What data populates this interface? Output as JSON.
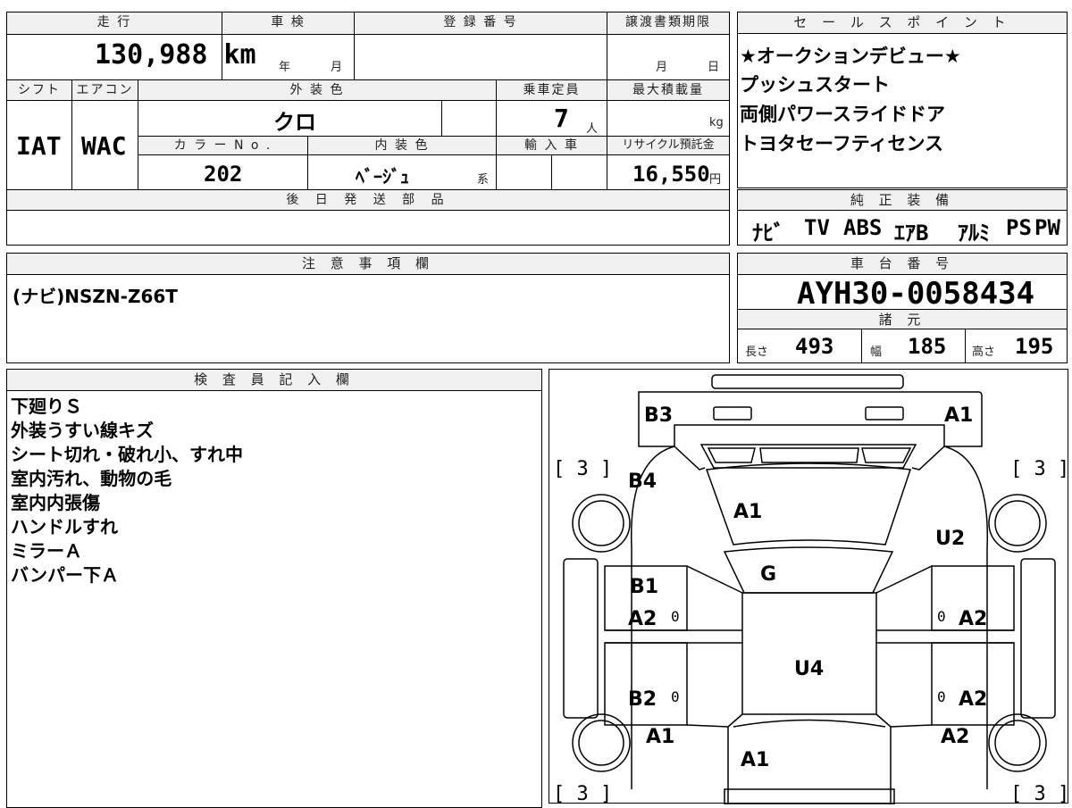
{
  "vehicle": {
    "headers": {
      "mileage": "走 行",
      "inspection": "車 検",
      "registration": "登 録 番 号",
      "transfer_deadline": "譲渡書類期限",
      "shift": "シフト",
      "aircon": "エアコン",
      "exterior_color": "外 装 色",
      "capacity": "乗車定員",
      "max_load": "最大積載量",
      "color_no": "カ ラ ー N o .",
      "interior_color": "内 装 色",
      "import": "輸 入 車",
      "recycle_fee": "リサイクル預託金",
      "later_parts": "後 日 発 送 部 品"
    },
    "mileage": "130,988 km",
    "inspection_year_unit": "年",
    "inspection_month_unit": "月",
    "transfer_month_unit": "月",
    "transfer_day_unit": "日",
    "shift": "IAT",
    "aircon": "WAC",
    "exterior_color": "クロ",
    "capacity": "7",
    "capacity_unit": "人",
    "max_load_unit": "kg",
    "color_no": "202",
    "interior_color": "ﾍﾞｰｼﾞｭ",
    "interior_suffix": "系",
    "recycle_fee": "16,550",
    "recycle_unit": "円"
  },
  "sales_points": {
    "header": "セ ー ル ス ポ イ ン ト",
    "items": [
      "★オークションデビュー★",
      "プッシュスタート",
      "両側パワースライドドア",
      "トヨタセーフティセンス"
    ]
  },
  "equipment": {
    "header": "純 正 装 備",
    "items": [
      "ﾅﾋﾞ",
      "TV",
      "ABS",
      "ｴｱB",
      "ｱﾙﾐ",
      "PS",
      "PW"
    ]
  },
  "notes": {
    "header": "注 意 事 項 欄",
    "text": "(ナビ)NSZN-Z66T"
  },
  "chassis": {
    "header": "車 台 番 号",
    "number": "AYH30-0058434",
    "spec_header": "諸 元",
    "length_label": "長さ",
    "length": "493",
    "width_label": "幅",
    "width": "185",
    "height_label": "高さ",
    "height": "195"
  },
  "inspector": {
    "header": "検 査 員 記 入 欄",
    "lines": [
      "下廻りＳ",
      "外装うすい線キズ",
      "シート切れ・破れ小、すれ中",
      "室内汚れ、動物の毛",
      "室内内張傷",
      "ハンドルすれ",
      "ミラーＡ",
      "バンパー下Ａ"
    ]
  },
  "damage_map": {
    "labels": {
      "rear_left": "B3",
      "rear_right": "A1",
      "rear_quarter_left": "B4",
      "rear_quarter_right": "U2",
      "rear_glass": "A1",
      "roof_front_glass": "G",
      "left_rear_door": "B1",
      "left_rear_door2": "A2",
      "right_rear_door": "A2",
      "roof": "U4",
      "left_front_door": "B2",
      "right_front_door": "A2",
      "left_fender": "A1",
      "right_fender": "A2",
      "hood": "A1"
    },
    "tire_left_top": "[ 3 ]",
    "tire_right_top": "[ 3 ]",
    "tire_left_bottom": "[ 3 ]",
    "tire_right_bottom": "[ 3 ]",
    "zero": "0"
  }
}
